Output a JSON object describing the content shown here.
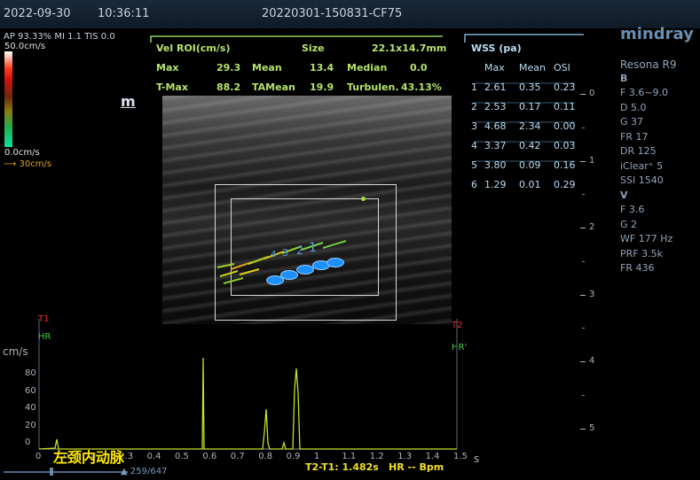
{
  "topbar": {
    "date": "2022-09-30",
    "time": "10:36:11",
    "study_id": "20220301-150831-CF75"
  },
  "ap_line": "AP 93.33%  MI 1.1  TIS 0.0",
  "colorbar": {
    "top": "50.0cm/s",
    "bottom": "0.0cm/s",
    "arrow_label": "30cm/s"
  },
  "mark": "m",
  "vel_panel": {
    "title": "Vel ROI(cm/s)",
    "size_label": "Size",
    "size_value": "22.1x14.7mm",
    "max_label": "Max",
    "max_value": "29.3",
    "mean_label": "Mean",
    "mean_value": "13.4",
    "median_label": "Median",
    "median_value": "0.0",
    "tmax_label": "T-Max",
    "tmax_value": "88.2",
    "tamean_label": "TAMean",
    "tamean_value": "19.9",
    "turb_label": "Turbulen.",
    "turb_value": "43.13%"
  },
  "wss": {
    "title": "WSS (pa)",
    "headers": [
      "Max",
      "Mean",
      "OSI"
    ],
    "rows": [
      [
        "1",
        "2.61",
        "0.35",
        "0.23"
      ],
      [
        "2",
        "2.53",
        "0.17",
        "0.11"
      ],
      [
        "3",
        "4.68",
        "2.34",
        "0.00"
      ],
      [
        "4",
        "3.37",
        "0.42",
        "0.03"
      ],
      [
        "5",
        "3.80",
        "0.09",
        "0.16"
      ],
      [
        "6",
        "1.29",
        "0.01",
        "0.29"
      ]
    ]
  },
  "brand": "mindray",
  "device": {
    "model": "Resona R9",
    "b_title": "B",
    "b_params": [
      "F 3.6~9.0",
      "D 5.0",
      "G 37",
      "FR 17",
      "DR 125",
      "iClear⁺ 5",
      "SSI 1540"
    ],
    "v_title": "V",
    "v_params": [
      "F 3.6",
      "G 2",
      "WF 177 Hz",
      "PRF 3.5k",
      "FR 436"
    ]
  },
  "depth_ticks": [
    "0",
    "1",
    "2",
    "3",
    "4",
    "5"
  ],
  "vessel_labels": [
    "1",
    "2",
    "3",
    "4"
  ],
  "trace": {
    "t1": "T1",
    "t2": "T2",
    "hr_left": "HR",
    "hr_right": "HR'",
    "unit": "cm/s",
    "sec_unit": "s",
    "y_ticks": [
      "80",
      "60",
      "40",
      "20",
      "0"
    ],
    "x_ticks": [
      "0",
      "0.1",
      "0.2",
      "0.3",
      "0.4",
      "0.5",
      "0.6",
      "0.7",
      "0.8",
      "0.9",
      "1",
      "1.1",
      "1.2",
      "1.3",
      "1.4",
      "1.5"
    ],
    "vessel_name": "左颈内动脉",
    "t2t1": "T2-T1: 1.482s",
    "hr": "HR -- Bpm",
    "frame": "259/647"
  },
  "colors": {
    "accent_green": "#b6e36a",
    "wss_blue": "#b8dcf0",
    "vessel_blue": "#1e8fff",
    "trace_yellow": "#c8e020"
  }
}
